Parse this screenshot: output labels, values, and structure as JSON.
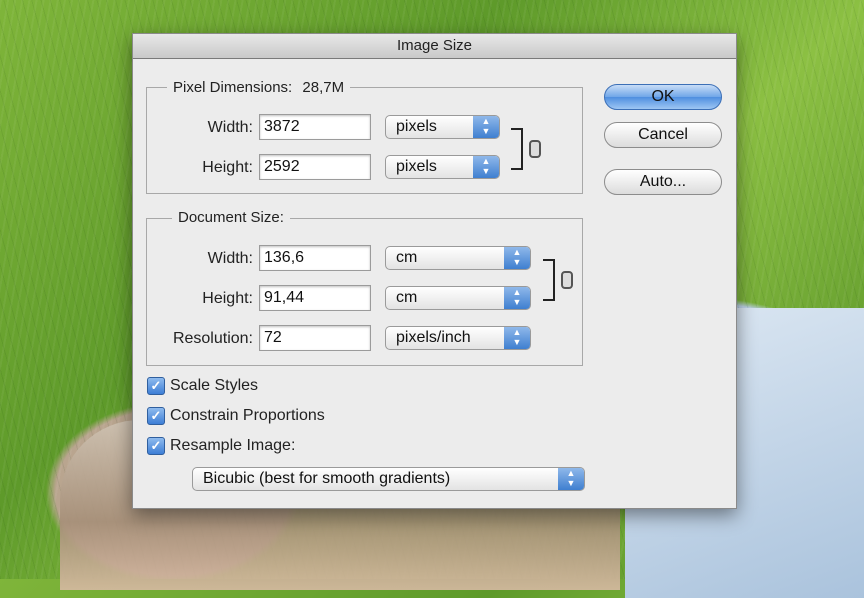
{
  "dialog": {
    "title": "Image Size"
  },
  "pixel_dimensions": {
    "legend": "Pixel Dimensions:",
    "size": "28,7M",
    "width_label": "Width:",
    "width_value": "3872",
    "width_unit": "pixels",
    "height_label": "Height:",
    "height_value": "2592",
    "height_unit": "pixels"
  },
  "document_size": {
    "legend": "Document Size:",
    "width_label": "Width:",
    "width_value": "136,6",
    "width_unit": "cm",
    "height_label": "Height:",
    "height_value": "91,44",
    "height_unit": "cm",
    "resolution_label": "Resolution:",
    "resolution_value": "72",
    "resolution_unit": "pixels/inch"
  },
  "buttons": {
    "ok": "OK",
    "cancel": "Cancel",
    "auto": "Auto..."
  },
  "options": {
    "scale_styles": {
      "label": "Scale Styles",
      "checked": true
    },
    "constrain_proportions": {
      "label": "Constrain Proportions",
      "checked": true
    },
    "resample_image": {
      "label": "Resample Image:",
      "checked": true
    },
    "resample_method": "Bicubic (best for smooth gradients)"
  },
  "icons": {
    "chain": "chain-link-icon",
    "stepper": "up-down-arrows-icon",
    "checkmark": "checkmark-icon"
  },
  "colors": {
    "accent": "#4f8fe0",
    "dialog_bg": "#ececec"
  }
}
